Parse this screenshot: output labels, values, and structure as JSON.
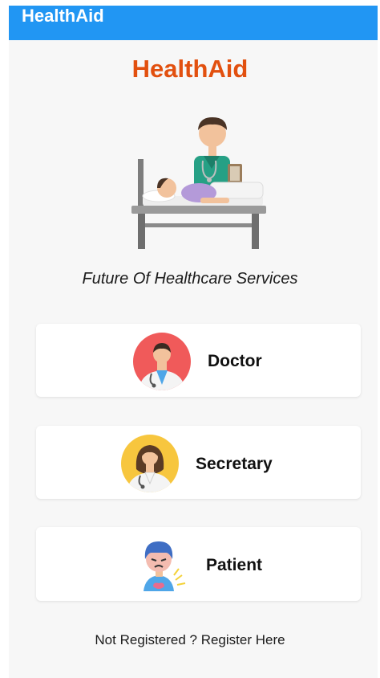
{
  "app_bar": {
    "title": "HealthAid"
  },
  "hero": {
    "brand_title": "HealthAid",
    "illustration_icon": "doctor-with-patient-in-bed-icon",
    "tagline": "Future Of Healthcare Services"
  },
  "roles": [
    {
      "label": "Doctor",
      "icon": "doctor-avatar-icon"
    },
    {
      "label": "Secretary",
      "icon": "secretary-avatar-icon"
    },
    {
      "label": "Patient",
      "icon": "patient-avatar-icon"
    }
  ],
  "footer": {
    "register_link": "Not Registered ? Register Here"
  },
  "colors": {
    "app_bar": "#2196f3",
    "brand_title": "#e2500f",
    "background": "#f7f7f7",
    "card": "#ffffff"
  }
}
